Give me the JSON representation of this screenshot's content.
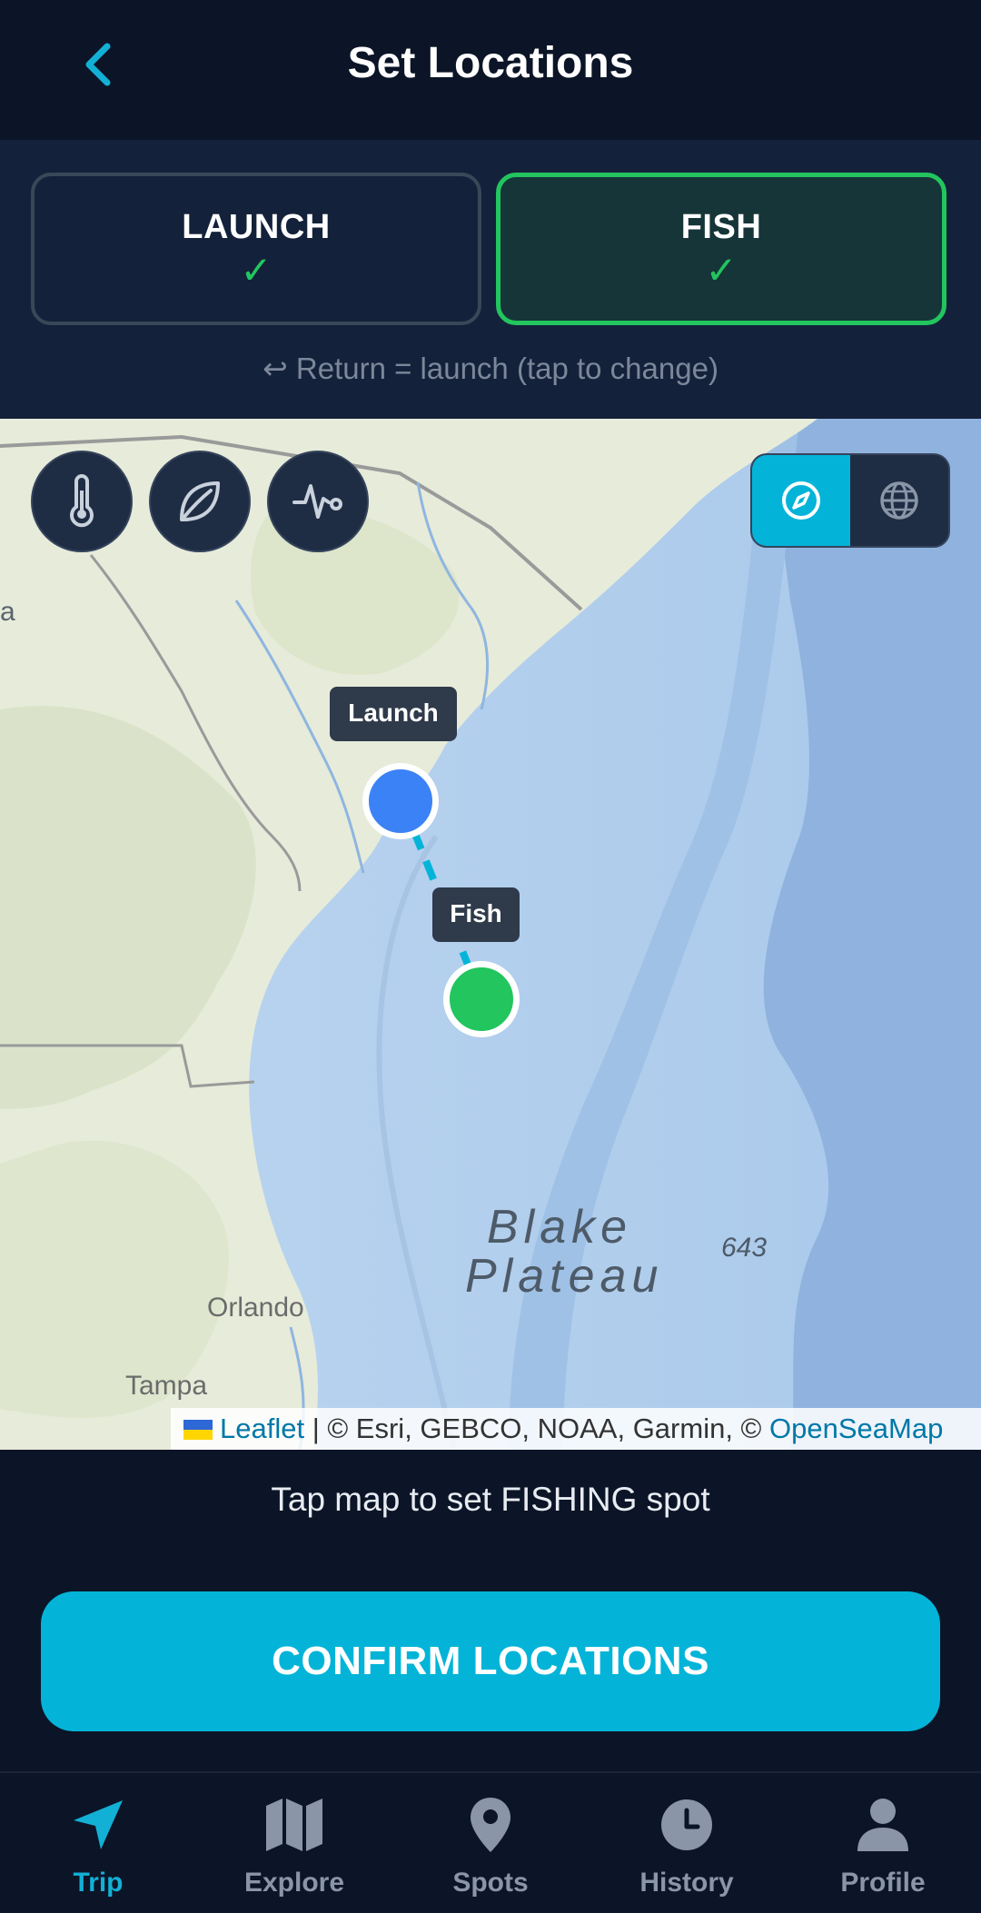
{
  "header": {
    "title": "Set Locations"
  },
  "segments": {
    "launch": {
      "label": "LAUNCH",
      "check": "✓"
    },
    "fish": {
      "label": "FISH",
      "check": "✓"
    }
  },
  "return_hint": "↩ Return = launch (tap to change)",
  "map": {
    "markers": {
      "launch": {
        "label": "Launch",
        "color": "#3b82f6"
      },
      "fish": {
        "label": "Fish",
        "color": "#22c55e"
      }
    },
    "labels": {
      "plateau_line1": "Blake",
      "plateau_line2": "Plateau",
      "depth": "643",
      "orlando": "Orlando",
      "tampa": "Tampa",
      "edge_letter": "a"
    },
    "attribution": {
      "leaflet": "Leaflet",
      "middle": " | © Esri, GEBCO, NOAA, Garmin, © ",
      "openseamap": "OpenSeaMap"
    }
  },
  "instruction": "Tap map to set FISHING spot",
  "confirm_button": "CONFIRM LOCATIONS",
  "nav": {
    "items": [
      {
        "label": "Trip",
        "icon": "navigation-arrow-icon"
      },
      {
        "label": "Explore",
        "icon": "map-icon"
      },
      {
        "label": "Spots",
        "icon": "map-pin-icon"
      },
      {
        "label": "History",
        "icon": "clock-icon"
      },
      {
        "label": "Profile",
        "icon": "user-icon"
      }
    ],
    "active": "Trip"
  },
  "colors": {
    "accent": "#04b4d8",
    "success": "#22c55e",
    "background": "#0b1527",
    "panel": "#14213a"
  }
}
